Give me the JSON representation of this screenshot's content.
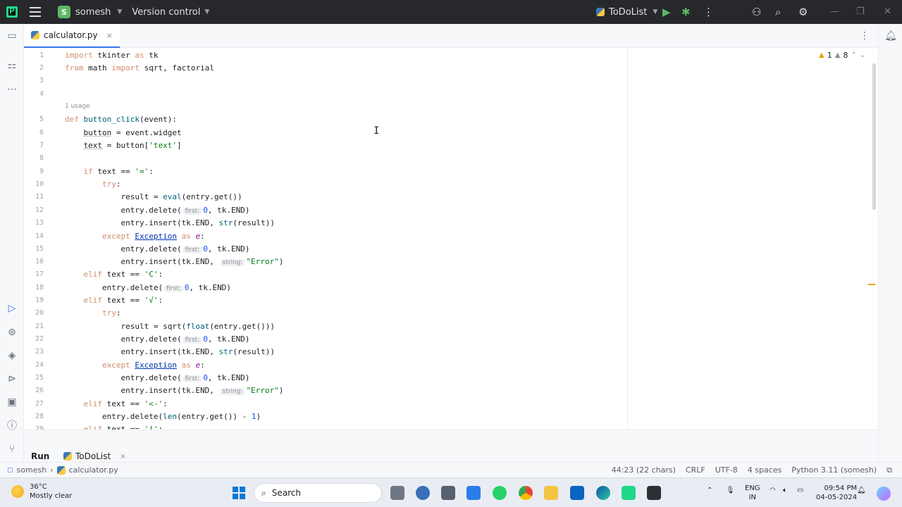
{
  "titlebar": {
    "project_badge": "S",
    "project_name": "somesh",
    "vcs_label": "Version control",
    "run_config": "ToDoList"
  },
  "editor": {
    "tab_label": "calculator.py",
    "tab_close": "×",
    "inspection": {
      "warnings": "1",
      "weak_warnings": "8"
    },
    "usage_hint": "1 usage",
    "line_numbers": [
      "1",
      "2",
      "3",
      "4",
      "5",
      "6",
      "7",
      "8",
      "9",
      "10",
      "11",
      "12",
      "13",
      "14",
      "15",
      "16",
      "17",
      "18",
      "19",
      "20",
      "21",
      "22",
      "23",
      "24",
      "25",
      "26",
      "27",
      "28",
      "29"
    ],
    "hints": {
      "first": "first:",
      "string": "string:"
    }
  },
  "bottom": {
    "run_tab": "Run",
    "todo_tab": "ToDoList",
    "todo_close": "×"
  },
  "statusbar": {
    "crumb_project": "somesh",
    "crumb_file": "calculator.py",
    "position": "44:23 (22 chars)",
    "line_sep": "CRLF",
    "encoding": "UTF-8",
    "indent": "4 spaces",
    "interpreter": "Python 3.11 (somesh)"
  },
  "taskbar": {
    "temperature": "36°C",
    "weather": "Mostly clear",
    "search": "Search",
    "lang_top": "ENG",
    "lang_bottom": "IN",
    "time": "09:54 PM",
    "date": "04-05-2024"
  },
  "colors": {
    "accent": "#3574f0",
    "keyword": "#0033b3",
    "string": "#067d17",
    "number": "#1750eb",
    "warning": "#e5a200"
  }
}
